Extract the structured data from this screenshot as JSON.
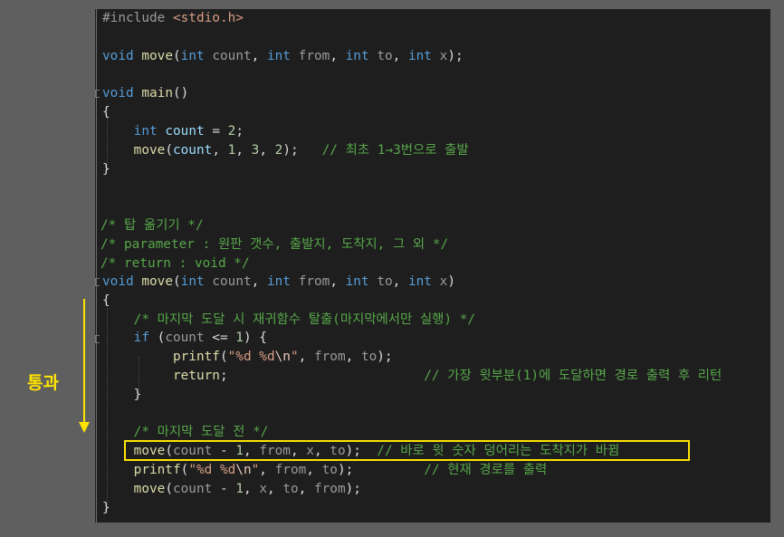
{
  "annotation": {
    "label": "통과",
    "highlight_color": "#ffe400"
  },
  "code": {
    "l1_pp": "#include",
    "l1_inc": "<stdio.h>",
    "l3": {
      "void": "void",
      "fn": "move",
      "int1": "int",
      "p1": "count",
      "int2": "int",
      "p2": "from",
      "int3": "int",
      "p3": "to",
      "int4": "int",
      "p4": "x"
    },
    "l5": {
      "void": "void",
      "fn": "main",
      "rest": "()"
    },
    "l6": "{",
    "l7": {
      "int": "int",
      "var": "count",
      "rest": " = ",
      "num": "2",
      "end": ";"
    },
    "l8": {
      "fn": "move",
      "var": "count",
      "n1": "1",
      "n2": "3",
      "n3": "2",
      "comment": "// 최초 1→3번으로 출발"
    },
    "l9": "}",
    "l12": "/* 탑 옮기기 */",
    "l13": "/* parameter : 원판 갯수, 출발지, 도착지, 그 외 */",
    "l14": "/* return : void */",
    "l15": {
      "void": "void",
      "fn": "move",
      "int1": "int",
      "p1": "count",
      "int2": "int",
      "p2": "from",
      "int3": "int",
      "p3": "to",
      "int4": "int",
      "p4": "x"
    },
    "l16": "{",
    "l17": "/* 마지막 도달 시 재귀함수 탈출(마지막에서만 실행) */",
    "l18": {
      "if": "if",
      "var": "count",
      "op": " <= ",
      "num": "1",
      "end": ") {"
    },
    "l19": {
      "fn": "printf",
      "str": "\"%d %d",
      "esc": "\\n",
      "strend": "\"",
      "p1": "from",
      "p2": "to"
    },
    "l20": {
      "kw": "return",
      "comment": "// 가장 윗부분(1)에 도달하면 경로 출력 후 리턴"
    },
    "l21": "}",
    "l23": "/* 마지막 도달 전 */",
    "l24": {
      "fn": "move",
      "var": "count",
      "num": "1",
      "p1": "from",
      "p2": "x",
      "p3": "to",
      "comment": "// 바로 윗 숫자 덩어리는 도착지가 바뀜"
    },
    "l25": {
      "fn": "printf",
      "str": "\"%d %d",
      "esc": "\\n",
      "strend": "\"",
      "p1": "from",
      "p2": "to",
      "comment": "// 현재 경로를 출력"
    },
    "l26": {
      "fn": "move",
      "var": "count",
      "num": "1",
      "p1": "x",
      "p2": "to",
      "p3": "from"
    },
    "l27": "}"
  }
}
